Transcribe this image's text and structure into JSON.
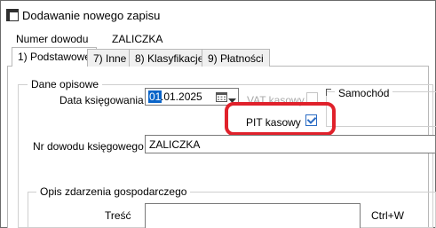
{
  "window": {
    "title": "Dodawanie nowego zapisu"
  },
  "document_number": {
    "label": "Numer dowodu",
    "value": "ZALICZKA"
  },
  "tabs": [
    {
      "label": "1) Podstawowe",
      "active": true
    },
    {
      "label": "7) Inne",
      "active": false
    },
    {
      "label": "8) Klasyfikacje",
      "active": false
    },
    {
      "label": "9) Płatności",
      "active": false
    }
  ],
  "dane_opisowe": {
    "legend": "Dane opisowe",
    "data_ksiegowania": {
      "label": "Data księgowania",
      "value_selected": "01",
      "value_rest": ".01.2025"
    },
    "vat_kasowy": {
      "label": "VAT kasowy",
      "checked": false,
      "enabled": false
    },
    "pit_kasowy": {
      "label": "PIT kasowy",
      "checked": true
    },
    "samochod": {
      "legend": "Samochód"
    },
    "nr_dowodu_ksiegowego": {
      "label": "Nr dowodu księgowego",
      "value": "ZALICZKA"
    }
  },
  "opis_zdarzenia": {
    "legend": "Opis zdarzenia gospodarczego",
    "tresc": {
      "label": "Treść",
      "value": "",
      "shortcut": "Ctrl+W"
    }
  },
  "colors": {
    "highlight": "#e0212b",
    "checkbox_accent": "#2b6cc4",
    "selection": "#0a64c8"
  }
}
